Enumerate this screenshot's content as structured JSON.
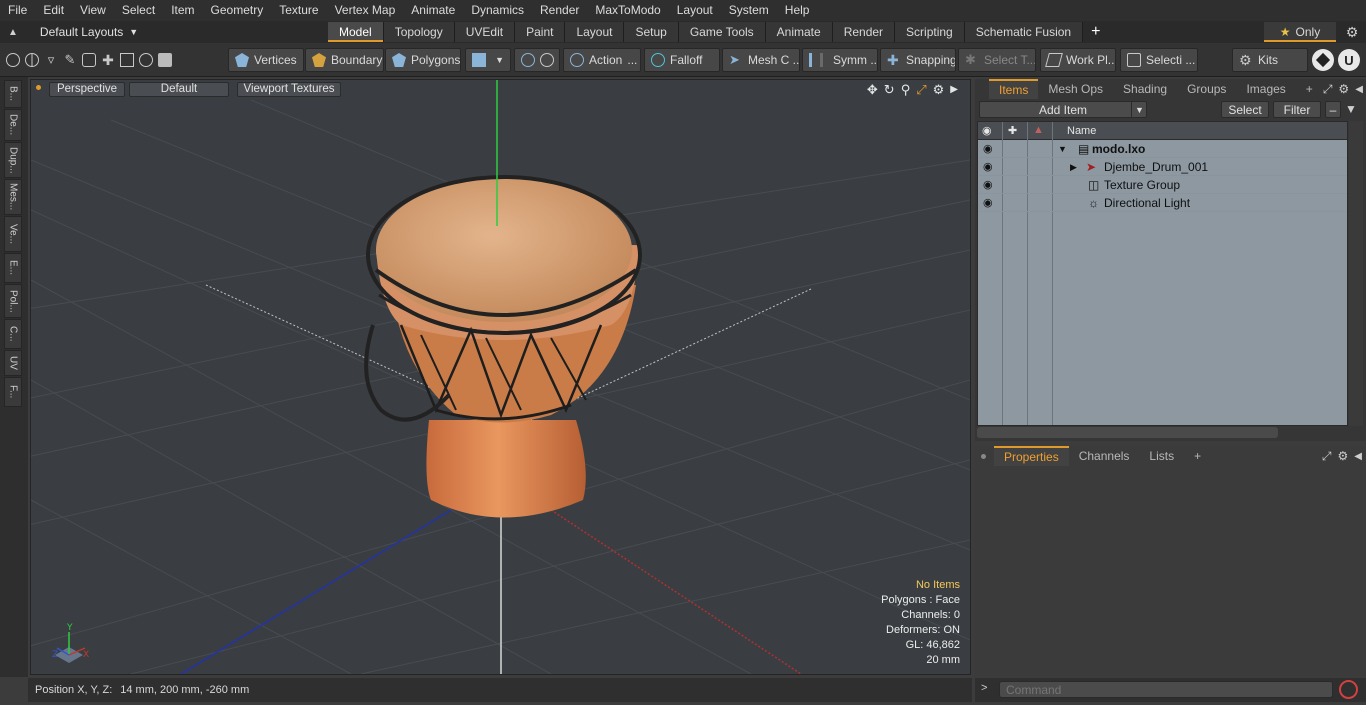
{
  "menu": [
    "File",
    "Edit",
    "View",
    "Select",
    "Item",
    "Geometry",
    "Texture",
    "Vertex Map",
    "Animate",
    "Dynamics",
    "Render",
    "MaxToModo",
    "Layout",
    "System",
    "Help"
  ],
  "layout": {
    "preset": "Default Layouts",
    "tabs": [
      "Model",
      "Topology",
      "UVEdit",
      "Paint",
      "Layout",
      "Setup",
      "Game Tools",
      "Animate",
      "Render",
      "Scripting",
      "Schematic Fusion"
    ],
    "active_tab": "Model",
    "only_label": "Only"
  },
  "toolbar": {
    "vertices": "Vertices",
    "boundary": "Boundary",
    "polygons": "Polygons",
    "action": "Action",
    "falloff": "Falloff",
    "mesh": "Mesh C ...",
    "symm": "Symm ...",
    "snapping": "Snapping",
    "select_t": "Select T...",
    "work_pl": "Work Pl...",
    "selecti": "Selecti ...",
    "kits": "Kits"
  },
  "left_tabs": [
    "B...",
    "De...",
    "Dup...",
    "Mes...",
    "Ve...",
    "E...",
    "Pol...",
    "C...",
    "UV",
    "F..."
  ],
  "viewport": {
    "mode": "Perspective",
    "shading": "Default",
    "textures": "Viewport Textures",
    "info": {
      "selection": "No Items",
      "polygons": "Polygons : Face",
      "channels": "Channels: 0",
      "deformers": "Deformers: ON",
      "gl": "GL: 46,862",
      "unit": "20 mm"
    },
    "axis_labels": {
      "x": "X",
      "y": "Y",
      "z": "Z"
    }
  },
  "status": {
    "label": "Position X, Y, Z:",
    "value": "14 mm, 200 mm, -260 mm"
  },
  "items_panel": {
    "tabs": [
      "Items",
      "Mesh Ops",
      "Shading",
      "Groups",
      "Images"
    ],
    "active_tab": "Items",
    "add_item": "Add Item",
    "select": "Select",
    "filter": "Filter",
    "column_name": "Name",
    "rows": [
      {
        "label": "modo.lxo",
        "bold": true
      },
      {
        "label": "Djembe_Drum_001"
      },
      {
        "label": "Texture Group"
      },
      {
        "label": "Directional Light"
      }
    ]
  },
  "props_panel": {
    "tabs": [
      "Properties",
      "Channels",
      "Lists"
    ],
    "active_tab": "Properties"
  },
  "command": {
    "placeholder": "Command"
  },
  "colors": {
    "accent": "#e09a2a",
    "axis_x": "#c0392b",
    "axis_y": "#2ecc40",
    "axis_z": "#2233aa",
    "drum_head": "#d9a47a",
    "drum_body": "#d97f4f"
  }
}
